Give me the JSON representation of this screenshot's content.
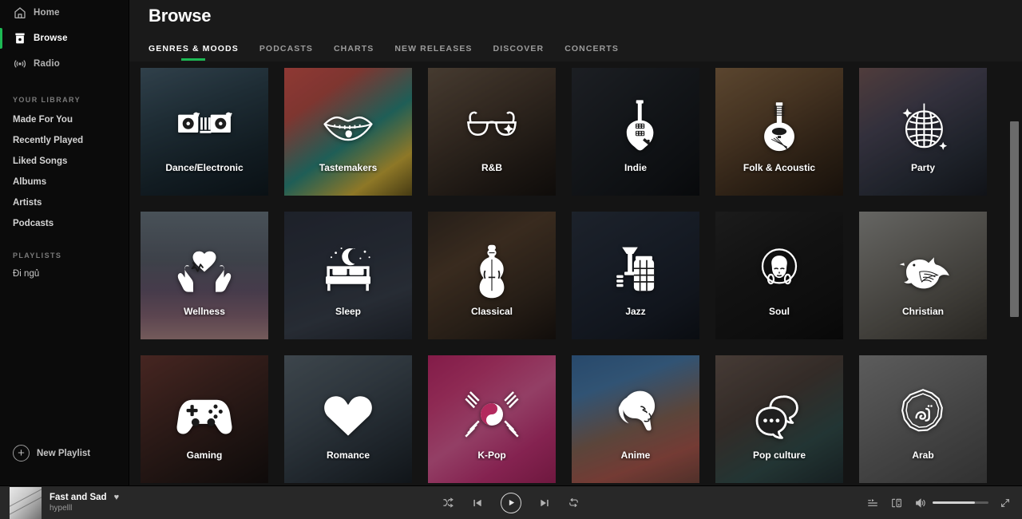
{
  "sidebar": {
    "nav": [
      {
        "label": "Home",
        "icon": "home-icon",
        "active": false
      },
      {
        "label": "Browse",
        "icon": "browse-icon",
        "active": true
      },
      {
        "label": "Radio",
        "icon": "radio-icon",
        "active": false
      }
    ],
    "library_heading": "YOUR LIBRARY",
    "library": [
      {
        "label": "Made For You"
      },
      {
        "label": "Recently Played"
      },
      {
        "label": "Liked Songs"
      },
      {
        "label": "Albums"
      },
      {
        "label": "Artists"
      },
      {
        "label": "Podcasts"
      }
    ],
    "playlists_heading": "PLAYLISTS",
    "playlists": [
      {
        "label": "Đi ngủ"
      }
    ],
    "new_playlist_label": "New Playlist",
    "new_playlist_icon": "plus-circle-icon",
    "accent_color": "#1db954"
  },
  "header": {
    "title": "Browse",
    "tabs": [
      {
        "label": "GENRES & MOODS",
        "active": true
      },
      {
        "label": "PODCASTS",
        "active": false
      },
      {
        "label": "CHARTS",
        "active": false
      },
      {
        "label": "NEW RELEASES",
        "active": false
      },
      {
        "label": "DISCOVER",
        "active": false
      },
      {
        "label": "CONCERTS",
        "active": false
      }
    ],
    "active_underline_color": "#1db954"
  },
  "grid": {
    "cards": [
      {
        "label": "Dance/Electronic",
        "icon": "turntables-icon",
        "bg": "linear-gradient(160deg,#4a6272 0%,#2e4450 35%,#1b2a33 70%,#101a20 100%)"
      },
      {
        "label": "Tastemakers",
        "icon": "lips-icon",
        "bg": "linear-gradient(145deg,#d9564f 0%,#c0524a 25%,#2f8f84 55%,#d8b63c 80%,#6b5a1e 100%)"
      },
      {
        "label": "R&B",
        "icon": "sunglasses-icon",
        "bg": "linear-gradient(150deg,#6b5a4a 0%,#4a3c30 40%,#2a221c 75%,#171310 100%)"
      },
      {
        "label": "Indie",
        "icon": "guitar-icon",
        "bg": "linear-gradient(140deg,#2b2f36 0%,#1d2126 45%,#14171b 80%,#0d0f12 100%)"
      },
      {
        "label": "Folk & Acoustic",
        "icon": "mandolin-icon",
        "bg": "linear-gradient(150deg,#8a6a48 0%,#6a4f34 35%,#42301f 70%,#241a11 100%)"
      },
      {
        "label": "Party",
        "icon": "disco-ball-icon",
        "bg": "linear-gradient(150deg,#7a5c5c 0%,#4e4a5c 35%,#2e3440 70%,#1a1d24 100%)"
      },
      {
        "label": "Wellness",
        "icon": "heart-hands-icon",
        "bg": "linear-gradient(180deg,#6f7c86 0%,#5d6470 38%,#6b5a72 62%,#8c6a7a 82%,#b08a8a 100%)"
      },
      {
        "label": "Sleep",
        "icon": "bed-moon-icon",
        "bg": "linear-gradient(160deg,#2d3340 0%,#333a47 40%,#3c434f 70%,#242a34 100%)"
      },
      {
        "label": "Classical",
        "icon": "violin-icon",
        "bg": "linear-gradient(150deg,#3a2f26 0%,#57422f 35%,#3a2d22 70%,#1b1511 100%)"
      },
      {
        "label": "Jazz",
        "icon": "trumpet-icon",
        "bg": "linear-gradient(150deg,#2c3442 0%,#222a38 40%,#1a202b 75%,#10141b 100%)"
      },
      {
        "label": "Soul",
        "icon": "afro-face-icon",
        "bg": "linear-gradient(150deg,#2a2a2a 0%,#1c1c1c 40%,#151515 75%,#0d0d0d 100%)"
      },
      {
        "label": "Christian",
        "icon": "dove-icon",
        "bg": "linear-gradient(150deg,#9a9a96 0%,#7c7a74 35%,#5c5952 70%,#3d3a34 100%)"
      },
      {
        "label": "Gaming",
        "icon": "gamepad-icon",
        "bg": "linear-gradient(150deg,#6b3a33 0%,#4a2b26 35%,#2c1d1a 70%,#171110 100%)"
      },
      {
        "label": "Romance",
        "icon": "heart-icon",
        "bg": "linear-gradient(150deg,#5d6a74 0%,#46525c 38%,#2d3740 72%,#1a2026 100%)"
      },
      {
        "label": "K-Pop",
        "icon": "taegeuk-icon",
        "bg": "linear-gradient(145deg,#c62a6e 0%,#d8407f 25%,#e0609a 50%,#c9357a 75%,#a82560 100%)"
      },
      {
        "label": "Anime",
        "icon": "anime-face-icon",
        "bg": "linear-gradient(160deg,#3d6fa3 0%,#4b7fb0 25%,#8a6a5a 55%,#b05a50 78%,#7a4a40 100%)"
      },
      {
        "label": "Pop culture",
        "icon": "speech-bubbles-icon",
        "bg": "linear-gradient(150deg,#6b5a52 0%,#4e423c 38%,#35514f 70%,#223033 100%)"
      },
      {
        "label": "Arab",
        "icon": "arabic-medallion-icon",
        "bg": "linear-gradient(150deg,#8c8c8c 0%,#767676 35%,#5e5e5e 70%,#4a4a4a 100%)"
      }
    ]
  },
  "player": {
    "track_title": "Fast and Sad",
    "artist": "hypelll",
    "like_icon": "heart-icon",
    "album_art_icon": "album-art",
    "controls": [
      {
        "name": "shuffle",
        "icon": "shuffle-icon"
      },
      {
        "name": "previous",
        "icon": "previous-icon"
      },
      {
        "name": "play",
        "icon": "play-icon"
      },
      {
        "name": "next",
        "icon": "next-icon"
      },
      {
        "name": "repeat",
        "icon": "repeat-icon"
      }
    ],
    "right_controls": [
      {
        "name": "queue",
        "icon": "queue-icon"
      },
      {
        "name": "devices",
        "icon": "devices-icon"
      },
      {
        "name": "volume",
        "icon": "volume-icon"
      },
      {
        "name": "fullscreen",
        "icon": "fullscreen-icon"
      }
    ],
    "volume_percent": 75
  }
}
